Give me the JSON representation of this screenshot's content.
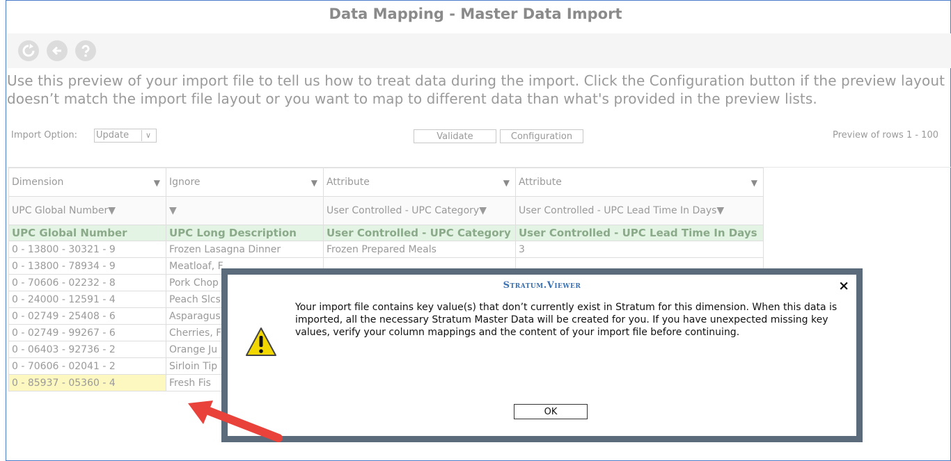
{
  "page": {
    "title": "Data Mapping - Master Data Import"
  },
  "toolbar": {
    "icons": [
      "refresh-icon",
      "back-icon",
      "help-icon"
    ]
  },
  "intro_text": "Use this preview of your import file to tell us how to treat data during the import. Click the Configuration button if the preview layout doesn’t match the import file layout or you want to map to different data than what's provided in the preview lists.",
  "controls": {
    "import_option_label": "Import Option:",
    "import_option_value": "Update",
    "validate_label": "Validate",
    "configuration_label": "Configuration",
    "preview_rows_text": "Preview of rows 1 - 100"
  },
  "grid": {
    "type_row": [
      "Dimension",
      "Ignore",
      "Attribute",
      "Attribute"
    ],
    "mapping_row": [
      "UPC Global Number",
      "",
      "User Controlled - UPC Category",
      "User Controlled - UPC Lead Time In Days"
    ],
    "header_row": [
      "UPC Global Number",
      "UPC Long Description",
      "User Controlled - UPC Category",
      "User Controlled - UPC Lead Time In Days"
    ],
    "rows": [
      [
        "0 - 13800 - 30321 - 9",
        "Frozen Lasagna Dinner",
        "Frozen Prepared Meals",
        "3"
      ],
      [
        "0 - 13800 - 78934 - 9",
        "Meatloaf, F",
        "",
        ""
      ],
      [
        "0 - 70606 - 02232 - 8",
        "Pork Chop",
        "",
        ""
      ],
      [
        "0 - 24000 - 12591 - 4",
        "Peach Slcs",
        "",
        ""
      ],
      [
        "0 - 02749 - 25408 - 6",
        "Asparagus",
        "",
        ""
      ],
      [
        "0 - 02749 - 99267 - 6",
        "Cherries, F",
        "",
        ""
      ],
      [
        "0 - 06403 - 92736 - 2",
        "Orange Ju",
        "",
        ""
      ],
      [
        "0 - 70606 - 02041 - 2",
        "Sirloin Tip",
        "",
        ""
      ],
      [
        "0 - 85937 - 05360 - 4",
        "Fresh Fis",
        "",
        ""
      ]
    ]
  },
  "dialog": {
    "title": "Stratum.Viewer",
    "message": "Your import file contains key value(s) that don’t currently exist in Stratum for this dimension. When this data is imported, all the necessary Stratum Master Data will be created for you. If you have unexpected missing key values, verify your column mappings and the content of your import file before continuing.",
    "ok_label": "OK",
    "close_glyph": "×"
  },
  "colors": {
    "accent_border": "#4a7bc8",
    "header_green": "#e4f4e4",
    "highlight_yellow": "#fdf8c0",
    "arrow_red": "#e8423a",
    "dialog_title_blue": "#3a70b0"
  }
}
